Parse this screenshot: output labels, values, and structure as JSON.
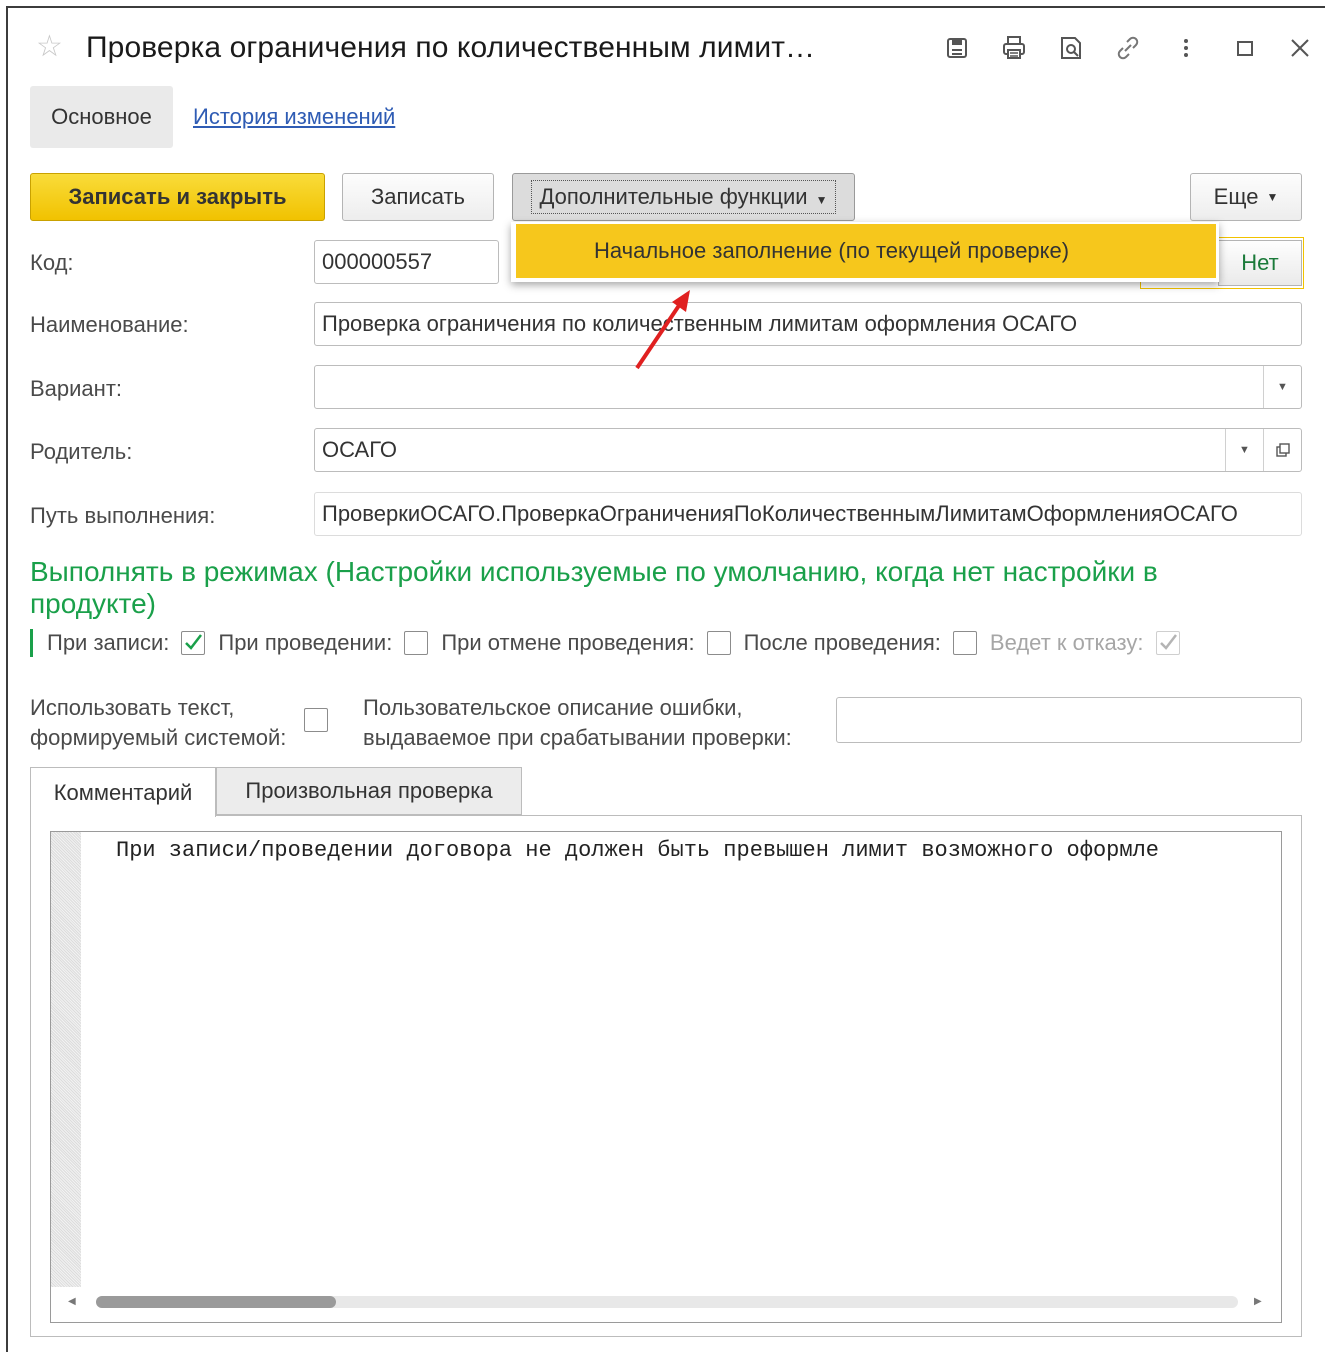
{
  "window": {
    "title": "Проверка ограничения по количественным лимит…",
    "icons": [
      "star-icon",
      "save-icon",
      "print-icon",
      "preview-icon",
      "link-icon",
      "more-vertical-icon",
      "maximize-icon",
      "close-icon"
    ]
  },
  "nav": {
    "tab_main": "Основное",
    "tab_history": "История изменений"
  },
  "toolbar": {
    "save_close_label": "Записать и закрыть",
    "save_label": "Записать",
    "additional_label": "Дополнительные функции",
    "more_label": "Еще",
    "net_label": "Нет"
  },
  "menu": {
    "item_initial_fill": "Начальное заполнение (по текущей проверке)"
  },
  "form": {
    "code_label": "Код:",
    "code_value": "000000557",
    "name_label": "Наименование:",
    "name_value": "Проверка ограничения по количественным лимитам оформления ОСАГО",
    "variant_label": "Вариант:",
    "variant_value": "",
    "parent_label": "Родитель:",
    "parent_value": "ОСАГО",
    "path_label": "Путь выполнения:",
    "path_value": "ПроверкиОСАГО.ПроверкаОграниченияПоКоличественнымЛимитамОформленияОСАГО"
  },
  "modes": {
    "title": "Выполнять в режимах (Настройки используемые по умолчанию, когда нет настройки в продукте)",
    "on_write_label": "При записи:",
    "on_write_checked": true,
    "on_post_label": "При проведении:",
    "on_post_checked": false,
    "on_unpost_label": "При отмене проведения:",
    "on_unpost_checked": false,
    "after_post_label": "После проведения:",
    "after_post_checked": false,
    "leads_refusal_label": "Ведет к отказу:",
    "leads_refusal_checked": true
  },
  "error_text": {
    "use_system_label_line1": "Использовать текст,",
    "use_system_label_line2": "формируемый системой:",
    "use_system_checked": false,
    "custom_label_line1": "Пользовательское описание ошибки,",
    "custom_label_line2": "выдаваемое при срабатывании проверки:",
    "custom_value": ""
  },
  "bottom_tabs": {
    "comment": "Комментарий",
    "custom_check": "Произвольная проверка"
  },
  "editor": {
    "text": "При записи/проведении договора не должен быть превышен лимит возможного оформле"
  },
  "colors": {
    "accent_yellow": "#f1c200",
    "section_green": "#1aa04a",
    "link_blue": "#2f5cb4",
    "annotation_red": "#e02020"
  }
}
